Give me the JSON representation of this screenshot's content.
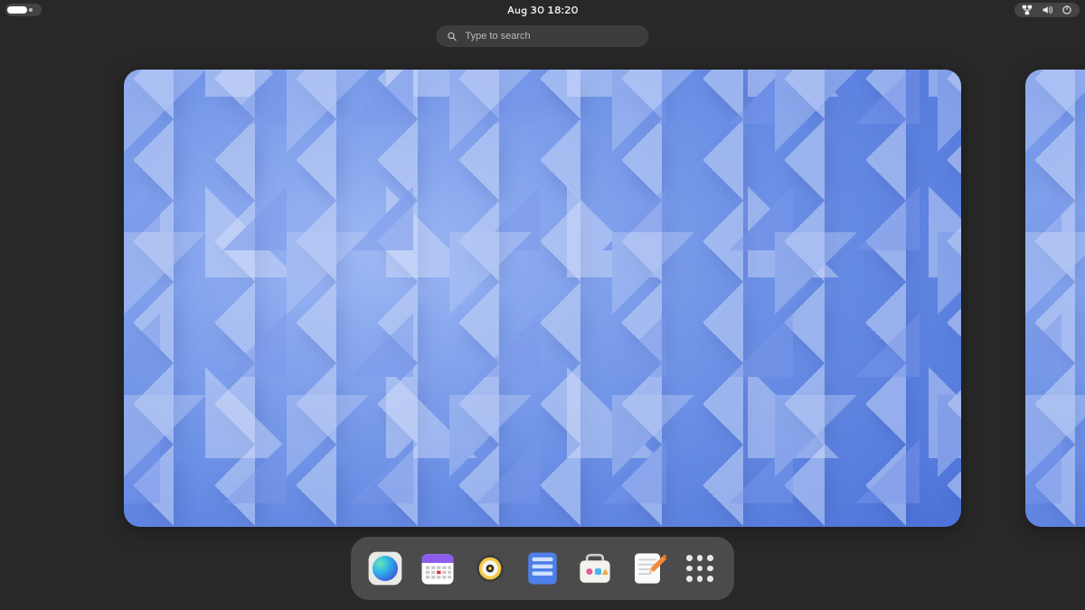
{
  "topbar": {
    "datetime": "Aug 30  18:20",
    "tray": {
      "network_icon": "network-wired-icon",
      "volume_icon": "volume-icon",
      "power_icon": "power-icon"
    }
  },
  "search": {
    "placeholder": "Type to search",
    "value": ""
  },
  "workspaces": {
    "current_index": 0,
    "count": 2
  },
  "dock": {
    "apps": [
      {
        "id": "web",
        "name": "web-browser-icon"
      },
      {
        "id": "calendar",
        "name": "calendar-icon"
      },
      {
        "id": "music",
        "name": "music-icon"
      },
      {
        "id": "todo",
        "name": "todo-icon"
      },
      {
        "id": "software",
        "name": "software-icon"
      },
      {
        "id": "editor",
        "name": "text-editor-icon"
      }
    ],
    "show_apps_icon": "app-grid-icon"
  }
}
